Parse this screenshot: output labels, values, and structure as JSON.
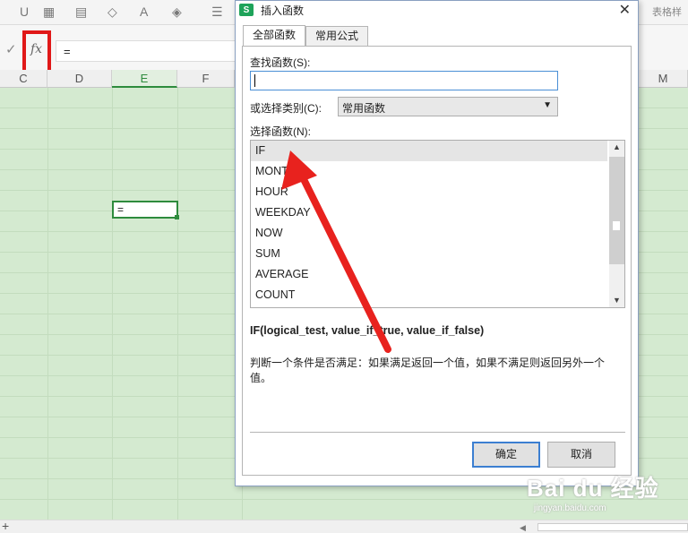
{
  "toolbar": {
    "buttons": [
      "U",
      "▦",
      "▤",
      "◇",
      "A",
      "◈",
      "☰"
    ],
    "right_label": "表格样"
  },
  "formula_bar": {
    "check": "✓",
    "fx": "fx",
    "value": "="
  },
  "columns": [
    {
      "label": "C"
    },
    {
      "label": "D"
    },
    {
      "label": "E"
    },
    {
      "label": "F"
    },
    {
      "label": "M"
    }
  ],
  "active_cell_value": "=",
  "dialog": {
    "title": "插入函数",
    "logo": "S",
    "close": "✕",
    "tabs": [
      "全部函数",
      "常用公式"
    ],
    "search_label": "查找函数(S):",
    "search_value": "",
    "category_label": "或选择类别(C):",
    "category_value": "常用函数",
    "list_label": "选择函数(N):",
    "functions": [
      "IF",
      "MONTH",
      "HOUR",
      "WEEKDAY",
      "NOW",
      "SUM",
      "AVERAGE",
      "COUNT"
    ],
    "selected_function": "IF",
    "signature": "IF(logical_test, value_if_true, value_if_false)",
    "description": "判断一个条件是否满足：如果满足返回一个值，如果不满足则返回另外一个值。",
    "ok_label": "确定",
    "cancel_label": "取消"
  },
  "watermark": {
    "main": "Bai du 经验",
    "sub": "jingyan.baidu.com"
  },
  "colors": {
    "highlight_red": "#e01818",
    "grid_green": "#d4ead0",
    "active_green": "#2e8b3d",
    "focus_blue": "#3c7fd1"
  }
}
